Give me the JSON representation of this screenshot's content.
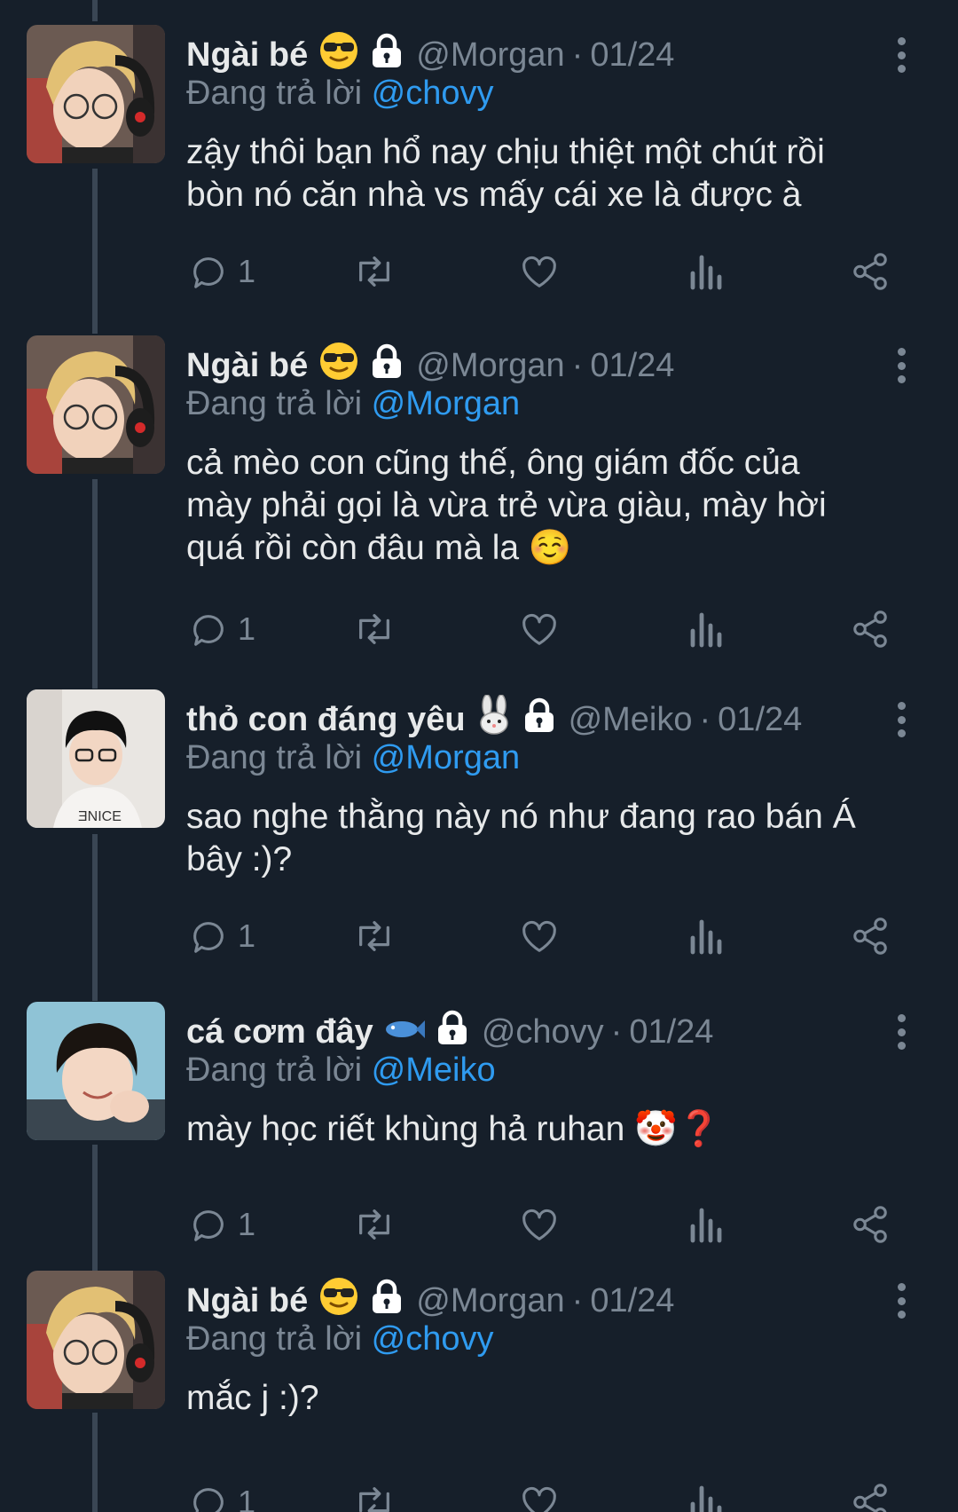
{
  "tweets": [
    {
      "name": "Ngài bé",
      "handle": "@Morgan",
      "date": "01/24",
      "reply_label": "Đang trả lời",
      "reply_to": "@chovy",
      "text_lines": [
        "zậy thôi bạn hổ nay chịu thiệt một chút rồi",
        "bòn nó căn nhà vs mấy cái xe là được à"
      ],
      "reply_count": "1",
      "emoji": "sunglasses-emoji",
      "avatar": "blonde-headset-avatar"
    },
    {
      "name": "Ngài bé",
      "handle": "@Morgan",
      "date": "01/24",
      "reply_label": "Đang trả lời",
      "reply_to": "@Morgan",
      "text_lines": [
        "cả mèo con cũng thế, ông giám đốc của",
        "mày phải gọi là vừa trẻ vừa giàu, mày hời",
        "quá rồi còn đâu mà la ☺️"
      ],
      "reply_count": "1",
      "emoji": "sunglasses-emoji",
      "avatar": "blonde-headset-avatar"
    },
    {
      "name": "thỏ con đáng yêu",
      "handle": "@Meiko",
      "date": "01/24",
      "reply_label": "Đang trả lời",
      "reply_to": "@Morgan",
      "text_lines": [
        "sao nghe thằng này nó như đang rao bán Á",
        "bây :)?"
      ],
      "reply_count": "1",
      "emoji": "rabbit-emoji",
      "avatar": "glasses-boy-avatar"
    },
    {
      "name": "cá cơm đây",
      "handle": "@chovy",
      "date": "01/24",
      "reply_label": "Đang trả lời",
      "reply_to": "@Meiko",
      "text_lines": [
        "mày học riết khùng hả ruhan 🤡❓"
      ],
      "reply_count": "1",
      "emoji": "fish-emoji",
      "avatar": "smiling-boy-avatar"
    },
    {
      "name": "Ngài bé",
      "handle": "@Morgan",
      "date": "01/24",
      "reply_label": "Đang trả lời",
      "reply_to": "@chovy",
      "text_lines": [
        "mắc j :)?"
      ],
      "reply_count": "1",
      "emoji": "sunglasses-emoji",
      "avatar": "blonde-headset-avatar"
    }
  ],
  "colors": {
    "background": "#161f2a",
    "text": "#e7e9ea",
    "muted": "#7b8794",
    "mention": "#2f9bf0",
    "thread_line": "#3a4654"
  },
  "icons": {
    "reply": "reply-icon",
    "retweet": "retweet-icon",
    "like": "heart-icon",
    "views": "views-icon",
    "share": "share-icon",
    "more": "more-options-icon",
    "lock": "lock-icon"
  }
}
